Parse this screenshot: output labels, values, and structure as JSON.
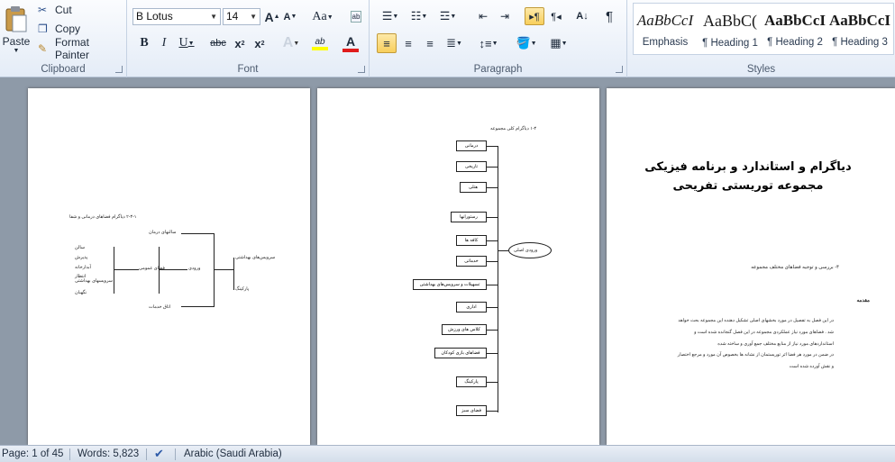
{
  "ribbon": {
    "clipboard": {
      "group_label": "Clipboard",
      "paste": "Paste",
      "cut": "Cut",
      "copy": "Copy",
      "format_painter": "Format Painter"
    },
    "font": {
      "group_label": "Font",
      "font_name": "B Lotus",
      "font_size": "14"
    },
    "paragraph": {
      "group_label": "Paragraph"
    },
    "styles": {
      "group_label": "Styles",
      "items": [
        {
          "preview": "AaBbCcI",
          "name": "Emphasis"
        },
        {
          "preview": "AaBbC(",
          "name": "¶ Heading 1"
        },
        {
          "preview": "AaBbCcI",
          "name": "¶ Heading 2"
        },
        {
          "preview": "AaBbCcI",
          "name": "¶ Heading 3"
        }
      ]
    }
  },
  "pages": {
    "page3": {
      "title_line1": "دیاگرام و استاندارد و برنامه فیزیکی",
      "title_line2": "مجموعه توریستی تفریحی",
      "section_heading": "۴- بررسی و توجیه فضاهای مختلف مجموعه",
      "subheading": "مقدمه",
      "para1": "در این فصل به تفصیل در مورد بخشهای اصلی تشکیل دهنده این مجموعه بحث خواهد",
      "para2": "شد . فضاهای مورد نیاز عملکردی مجموعه در این فصل گنجانده شده است و",
      "para3": "استانداردهای مورد نیاز از منابع مختلف جمع آوری و ساخته شده",
      "para4": "در ضمن در مورد هر فضا اثر توریستمان از نشانه ها بخصوص آن مورد و مرجع اختصار",
      "para5": "و نقش آورده شده است"
    },
    "page2": {
      "diagram_title": "۱-۴ دیاگرام کلی مجموعه",
      "center_node": "ورودی اصلی",
      "nodes": [
        "درمانی",
        "تاریخی",
        "هتلی",
        "رستورانها",
        "کافه ها",
        "خدماتی",
        "تسهیلات و سرویس‌های بهداشتی",
        "اداری",
        "کلاس های ورزش",
        "فضاهای بازی کودکان",
        "پارکینگ",
        "فضای سبز"
      ]
    },
    "page1": {
      "diagram_title": "۲-۴-۱ دیاگرام فضاهای درمانی و شفا",
      "left_items": [
        "سالن",
        "پذیرش",
        "آبدارخانه",
        "انتظار",
        "سرویسهای بهداشتی",
        "نگهبان"
      ],
      "mid_top": "سالنهای درمان",
      "mid_center": "فضای عمومی",
      "mid_bottom": "اتاق خدمات",
      "junction": "ورودی",
      "right_top": "سرویس‌های بهداشتی",
      "right_bottom": "پارکینگ"
    }
  },
  "status_bar": {
    "page": "Page: 1 of 45",
    "words": "Words: 5,823",
    "language": "Arabic (Saudi Arabia)"
  }
}
